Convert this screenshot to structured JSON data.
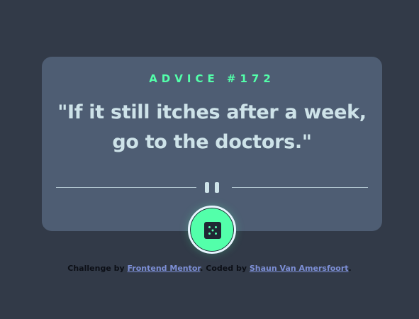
{
  "advice": {
    "heading": "ADVICE #172",
    "quote": "\"If it still itches after a week, go to the doctors.\""
  },
  "divider": {
    "icon": "pause-icon"
  },
  "button": {
    "icon": "dice-icon"
  },
  "footer": {
    "challenge_prefix": "Challenge by",
    "challenge_link": "Frontend Mentor",
    "coded_prefix": ". Coded by",
    "coded_link": "Shaun Van Amersfoort",
    "coded_suffix": "."
  },
  "colors": {
    "background": "#323a48",
    "card": "#4e5d73",
    "accent": "#53ffaa",
    "text": "#cee3e9",
    "link": "#7d8fd6"
  }
}
